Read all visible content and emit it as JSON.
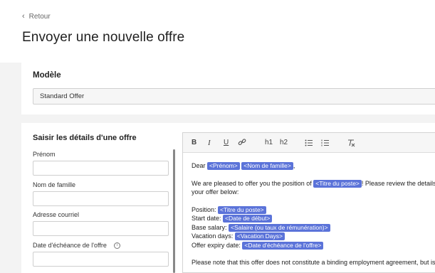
{
  "header": {
    "back_label": "Retour",
    "title": "Envoyer une nouvelle offre"
  },
  "model": {
    "section_title": "Modèle",
    "selected": "Standard Offer"
  },
  "details": {
    "section_title": "Saisir les détails d'une offre",
    "fields": [
      {
        "label": "Prénom",
        "value": ""
      },
      {
        "label": "Nom de famille",
        "value": ""
      },
      {
        "label": "Adresse courriel",
        "value": ""
      },
      {
        "label": "Date d'échéance de l'offre",
        "value": ""
      }
    ]
  },
  "editor": {
    "toolbar": {
      "bold": "B",
      "italic": "I",
      "underline": "U",
      "link": "link-icon",
      "h1": "h1",
      "h2": "h2",
      "bullet_list": "bullet-list-icon",
      "numbered_list": "numbered-list-icon",
      "clear_format": "clear-format-icon"
    },
    "dear": "Dear",
    "tag_prenom": "<Prénom>",
    "tag_nom": "<Nom de famille>",
    "dear_end": ",",
    "offer_intro": "We are pleased to offer you the position of",
    "tag_titre": "<Titre du poste>",
    "offer_intro_end": "! Please review the details",
    "offer_intro_2": "your offer below:",
    "position_label": "Position:",
    "start_label": "Start date:",
    "tag_date_debut": "<Date de début>",
    "salary_label": "Base salary:",
    "tag_salaire": "<Salaire (ou taux de rémunération)>",
    "vacation_label": "Vacation days:",
    "tag_vacation": "<Vacation Days>",
    "expiry_label": "Offer expiry date:",
    "tag_echeance": "<Date d'échéance de l'offre>",
    "note": "Please note that this offer does not constitute a binding employment agreement, but is"
  },
  "colors": {
    "tag_bg": "#5b73d9",
    "page_bg": "#f3f3f3"
  }
}
